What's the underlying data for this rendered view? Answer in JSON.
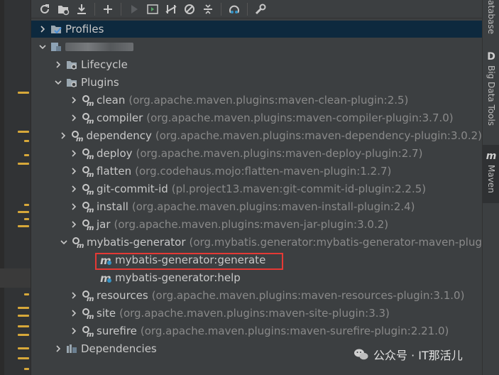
{
  "right_tabs": {
    "database": "atabase",
    "bigdata_icon": "D",
    "bigdata": "Big Data Tools",
    "maven_icon": "m",
    "maven": "Maven"
  },
  "toolbar": {
    "icons": [
      "reload-icon",
      "reimport-folder-icon",
      "download-icon",
      "add-icon",
      "run-icon",
      "execute-goal-icon",
      "toggle-offline-icon",
      "skip-tests-icon",
      "collapse-icon",
      "show-dependencies-icon",
      "settings-icon"
    ]
  },
  "tree": {
    "profiles": "Profiles",
    "lifecycle": "Lifecycle",
    "plugins": "Plugins",
    "plugin_list": [
      {
        "name": "clean",
        "coord": "(org.apache.maven.plugins:maven-clean-plugin:2.5)"
      },
      {
        "name": "compiler",
        "coord": "(org.apache.maven.plugins:maven-compiler-plugin:3.7.0)"
      },
      {
        "name": "dependency",
        "coord": "(org.apache.maven.plugins:maven-dependency-plugin:3.0.2)"
      },
      {
        "name": "deploy",
        "coord": "(org.apache.maven.plugins:maven-deploy-plugin:2.7)"
      },
      {
        "name": "flatten",
        "coord": "(org.codehaus.mojo:flatten-maven-plugin:1.2.7)"
      },
      {
        "name": "git-commit-id",
        "coord": "(pl.project13.maven:git-commit-id-plugin:2.2.5)"
      },
      {
        "name": "install",
        "coord": "(org.apache.maven.plugins:maven-install-plugin:2.4)"
      },
      {
        "name": "jar",
        "coord": "(org.apache.maven.plugins:maven-jar-plugin:3.0.2)"
      },
      {
        "name": "mybatis-generator",
        "coord": "(org.mybatis.generator:mybatis-generator-maven-plug"
      }
    ],
    "goals": [
      "mybatis-generator:generate",
      "mybatis-generator:help"
    ],
    "plugin_list2": [
      {
        "name": "resources",
        "coord": "(org.apache.maven.plugins:maven-resources-plugin:3.1.0)"
      },
      {
        "name": "site",
        "coord": "(org.apache.maven.plugins:maven-site-plugin:3.3)"
      },
      {
        "name": "surefire",
        "coord": "(org.apache.maven.plugins:maven-surefire-plugin:2.21.0)"
      }
    ],
    "dependencies": "Dependencies"
  },
  "watermark": {
    "text": "公众号 · IT那活儿"
  },
  "colors": {
    "highlight": "#e53935",
    "selection": "#0d293e",
    "marker": "#d7a83a"
  }
}
